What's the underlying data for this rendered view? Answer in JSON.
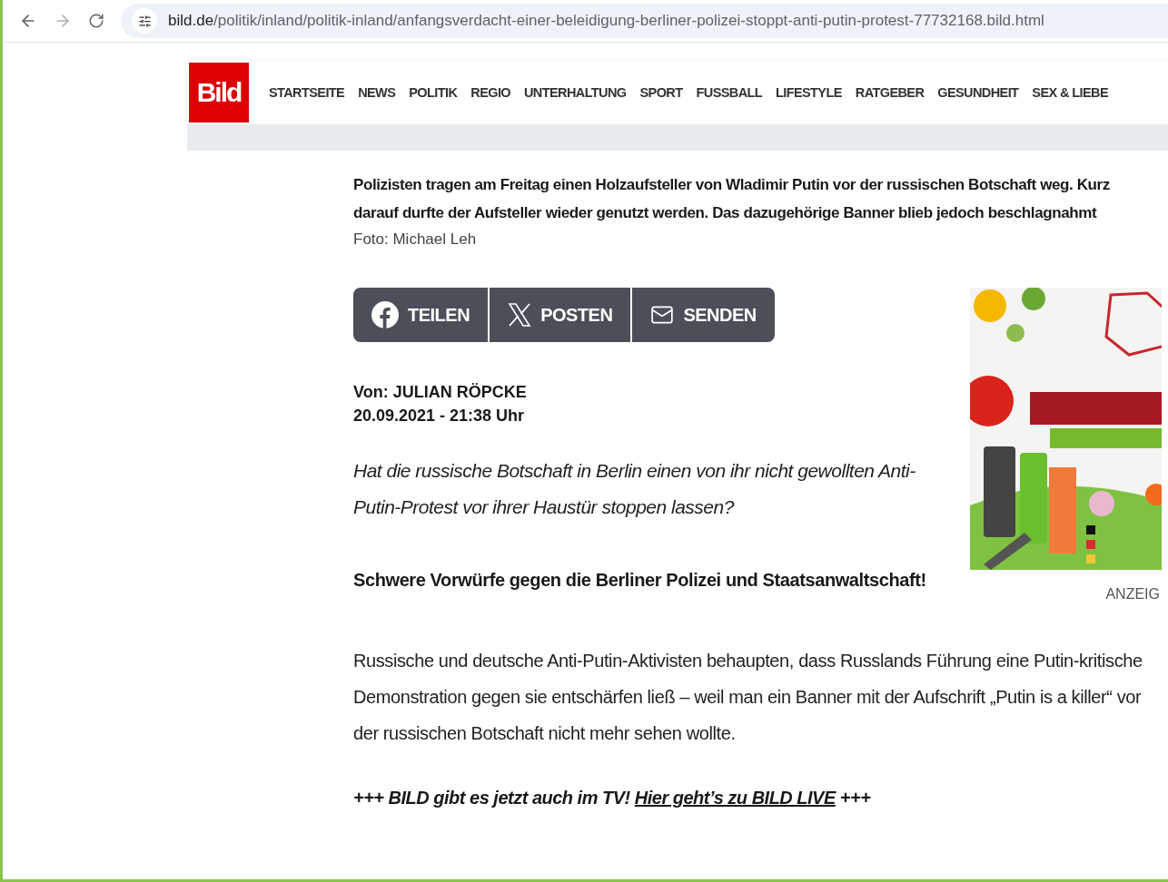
{
  "browser": {
    "url_host": "bild.de",
    "url_path": "/politik/inland/politik-inland/anfangsverdacht-einer-beleidigung-berliner-polizei-stoppt-anti-putin-protest-77732168.bild.html",
    "back_disabled": false,
    "forward_disabled": true
  },
  "header": {
    "logo": "Bild",
    "nav": [
      "STARTSEITE",
      "NEWS",
      "POLITIK",
      "REGIO",
      "UNTERHALTUNG",
      "SPORT",
      "FUSSBALL",
      "LIFESTYLE",
      "RATGEBER",
      "GESUNDHEIT",
      "SEX & LIEBE"
    ]
  },
  "article": {
    "caption": "Polizisten tragen am Freitag einen Holzaufsteller von Wladimir Putin vor der russischen Botschaft weg. Kurz darauf durfte der Aufsteller wieder genutzt werden. Das dazugehörige Banner blieb jedoch beschlagnahmt",
    "credit": "Foto: Michael Leh",
    "share": [
      {
        "kind": "facebook",
        "label": "TEILEN"
      },
      {
        "kind": "x",
        "label": "POSTEN"
      },
      {
        "kind": "mail",
        "label": "SENDEN"
      }
    ],
    "author": "Von: JULIAN RÖPCKE",
    "date": "20.09.2021 - 21:38 Uhr",
    "lede": "Hat die russische Botschaft in Berlin einen von ihr nicht gewollten Anti-Putin-Protest vor ihrer Haustür stoppen lassen?",
    "subhead": "Schwere Vorwürfe gegen die Berliner Polizei und Staatsanwaltschaft!",
    "body": "Russische und deutsche Anti-Putin-Aktivisten behaupten, dass Russlands Führung eine Putin-kritische Demonstration gegen sie entschärfen ließ – weil man ein Banner mit der Aufschrift „Putin is a killer“ vor der russischen Botschaft nicht mehr sehen wollte.",
    "promo": {
      "prefix": "+++ BILD gibt es jetzt auch im TV!",
      "link": "Hier geht’s zu BILD LIVE",
      "suffix": "+++"
    },
    "ad": {
      "kind": "picture",
      "label": "ANZEIG"
    }
  }
}
